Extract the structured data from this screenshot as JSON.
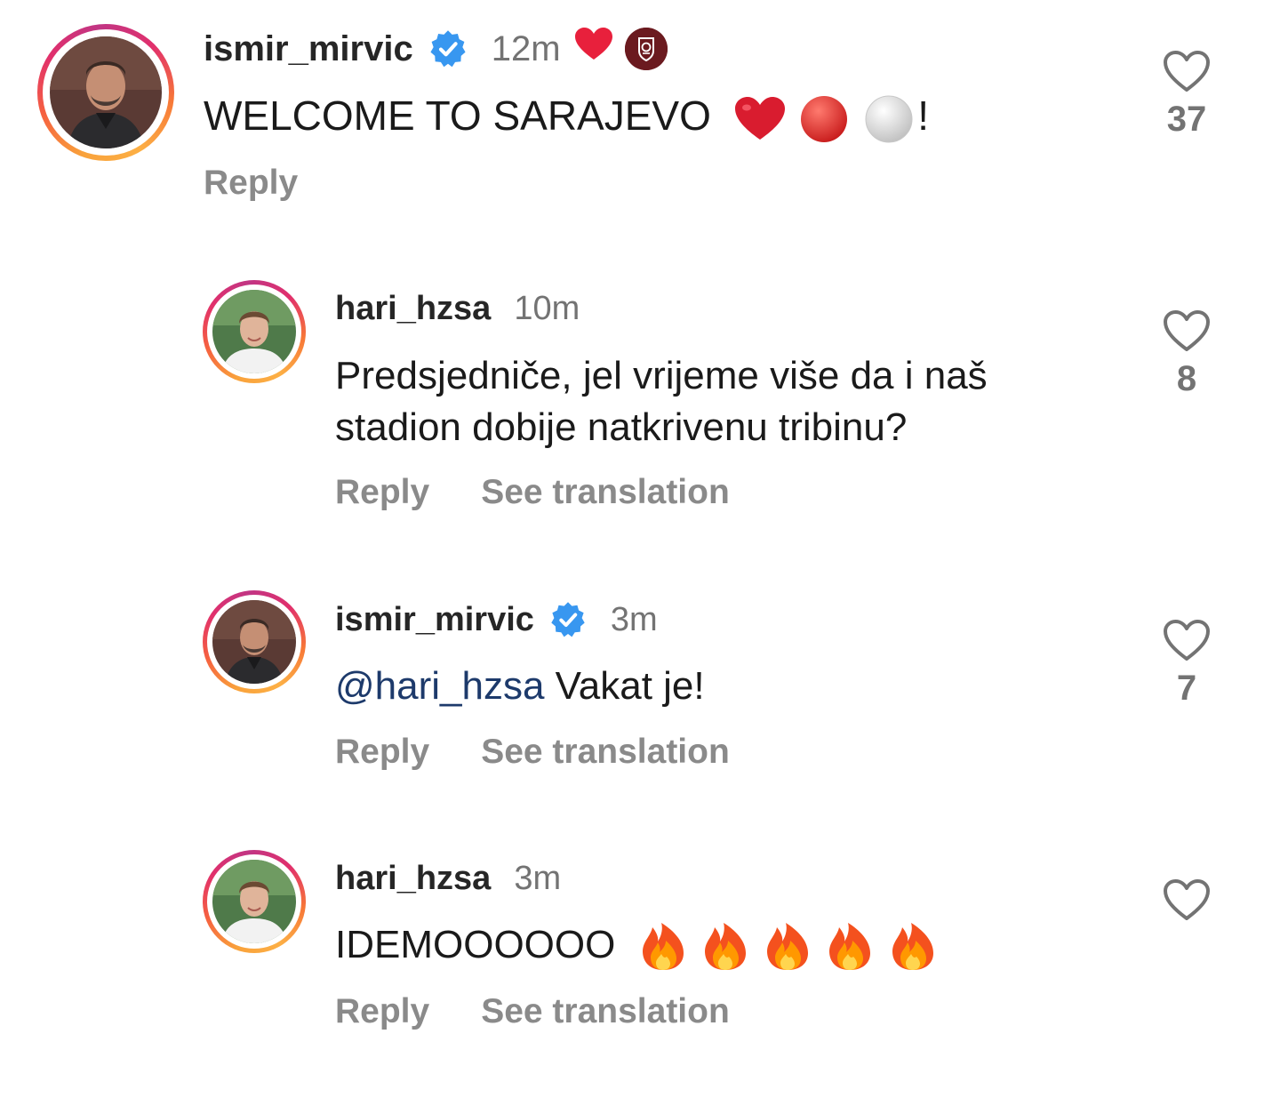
{
  "comments": [
    {
      "username": "ismir_mirvic",
      "verified": true,
      "time": "12m",
      "text": "WELCOME TO SARAJEVO",
      "text_suffix": "!",
      "text_emojis": [
        "red-heart-emoji",
        "red-circle-emoji",
        "white-circle-emoji"
      ],
      "header_icons": [
        "red-heart-icon",
        "club-crest-icon"
      ],
      "reply_label": "Reply",
      "like_count": "37"
    },
    {
      "username": "hari_hzsa",
      "verified": false,
      "time": "10m",
      "text_line1": "Predsjedniče, jel vrijeme više da i naš",
      "text_line2": "stadion dobije natkrivenu tribinu?",
      "reply_label": "Reply",
      "translate_label": "See translation",
      "like_count": "8"
    },
    {
      "username": "ismir_mirvic",
      "verified": true,
      "time": "3m",
      "mention": "@hari_hzsa",
      "text": " Vakat je!",
      "reply_label": "Reply",
      "translate_label": "See translation",
      "like_count": "7"
    },
    {
      "username": "hari_hzsa",
      "verified": false,
      "time": "3m",
      "text": "IDEMOOOOOO",
      "text_emojis": [
        "fire-emoji",
        "fire-emoji",
        "fire-emoji",
        "fire-emoji",
        "fire-emoji"
      ],
      "reply_label": "Reply",
      "translate_label": "See translation",
      "like_count": ""
    }
  ],
  "colors": {
    "username": "#262626",
    "meta": "#737373",
    "action": "#8a8a8a",
    "mention": "#1d3a6b",
    "verified": "#3897f0"
  }
}
